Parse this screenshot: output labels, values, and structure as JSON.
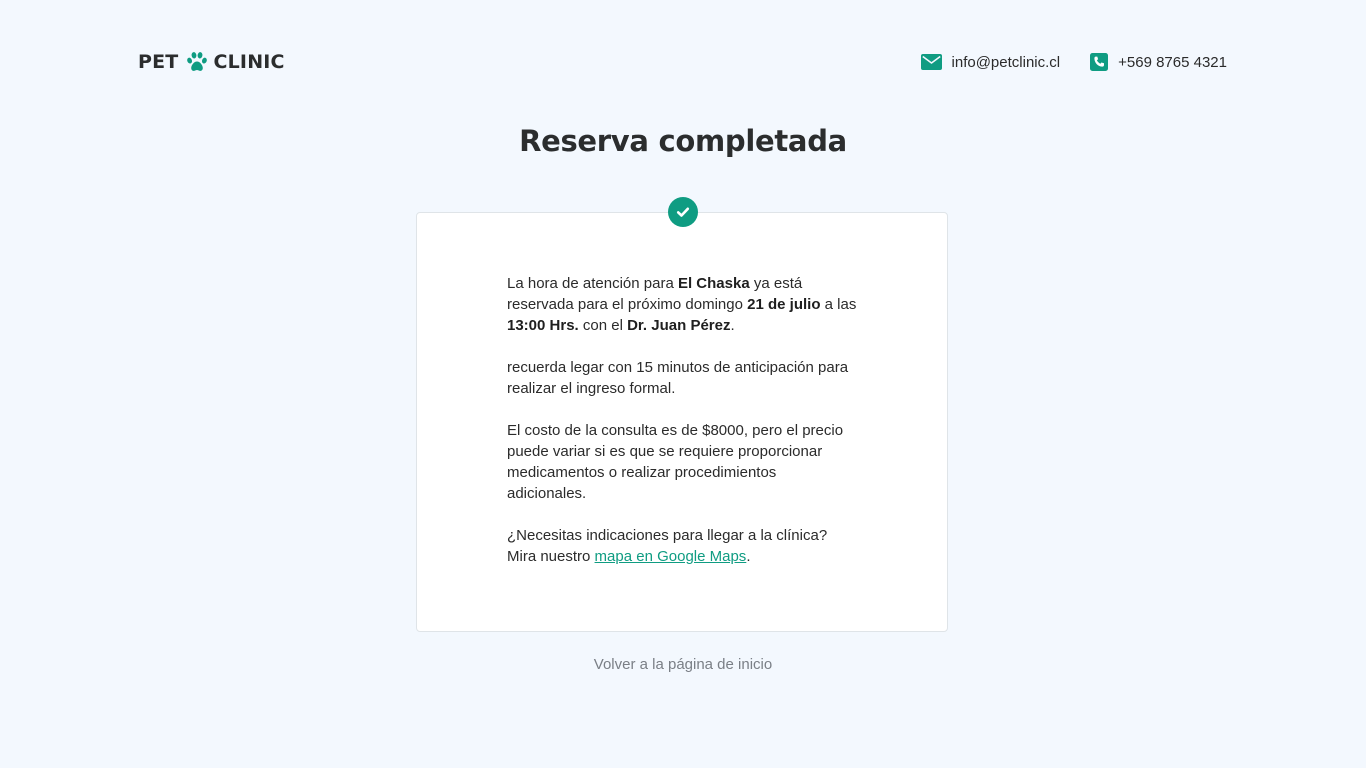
{
  "header": {
    "logo_left": "PET",
    "logo_right": "CLINIC",
    "email": "info@petclinic.cl",
    "phone": "+569 8765 4321"
  },
  "title": "Reserva completada",
  "message": {
    "p1_a": "La hora de atención para ",
    "pet_name": "El Chaska",
    "p1_b": " ya está reservada para el próximo domingo ",
    "date": "21 de julio",
    "p1_c": " a las ",
    "time": "13:00 Hrs.",
    "p1_d": " con el ",
    "doctor": "Dr. Juan Pérez",
    "p1_e": ".",
    "p2": "recuerda legar con 15 minutos de anticipación para realizar el ingreso formal.",
    "p3": "El costo de la consulta es de $8000, pero el precio puede variar si es que se requiere proporcionar medicamentos o realizar procedimientos adicionales.",
    "p4_a": "¿Necesitas indicaciones para llegar a la clínica? Mira nuestro ",
    "map_link": "mapa en Google Maps",
    "p4_b": "."
  },
  "back_link": "Volver a la página de inicio",
  "colors": {
    "accent": "#0f9c82",
    "background": "#f3f8fe",
    "text": "#2b2b2b",
    "muted": "#7a7f86"
  },
  "icons": {
    "logo": "paw-icon",
    "email": "envelope-icon",
    "phone": "phone-icon",
    "success": "check-circle-icon"
  }
}
